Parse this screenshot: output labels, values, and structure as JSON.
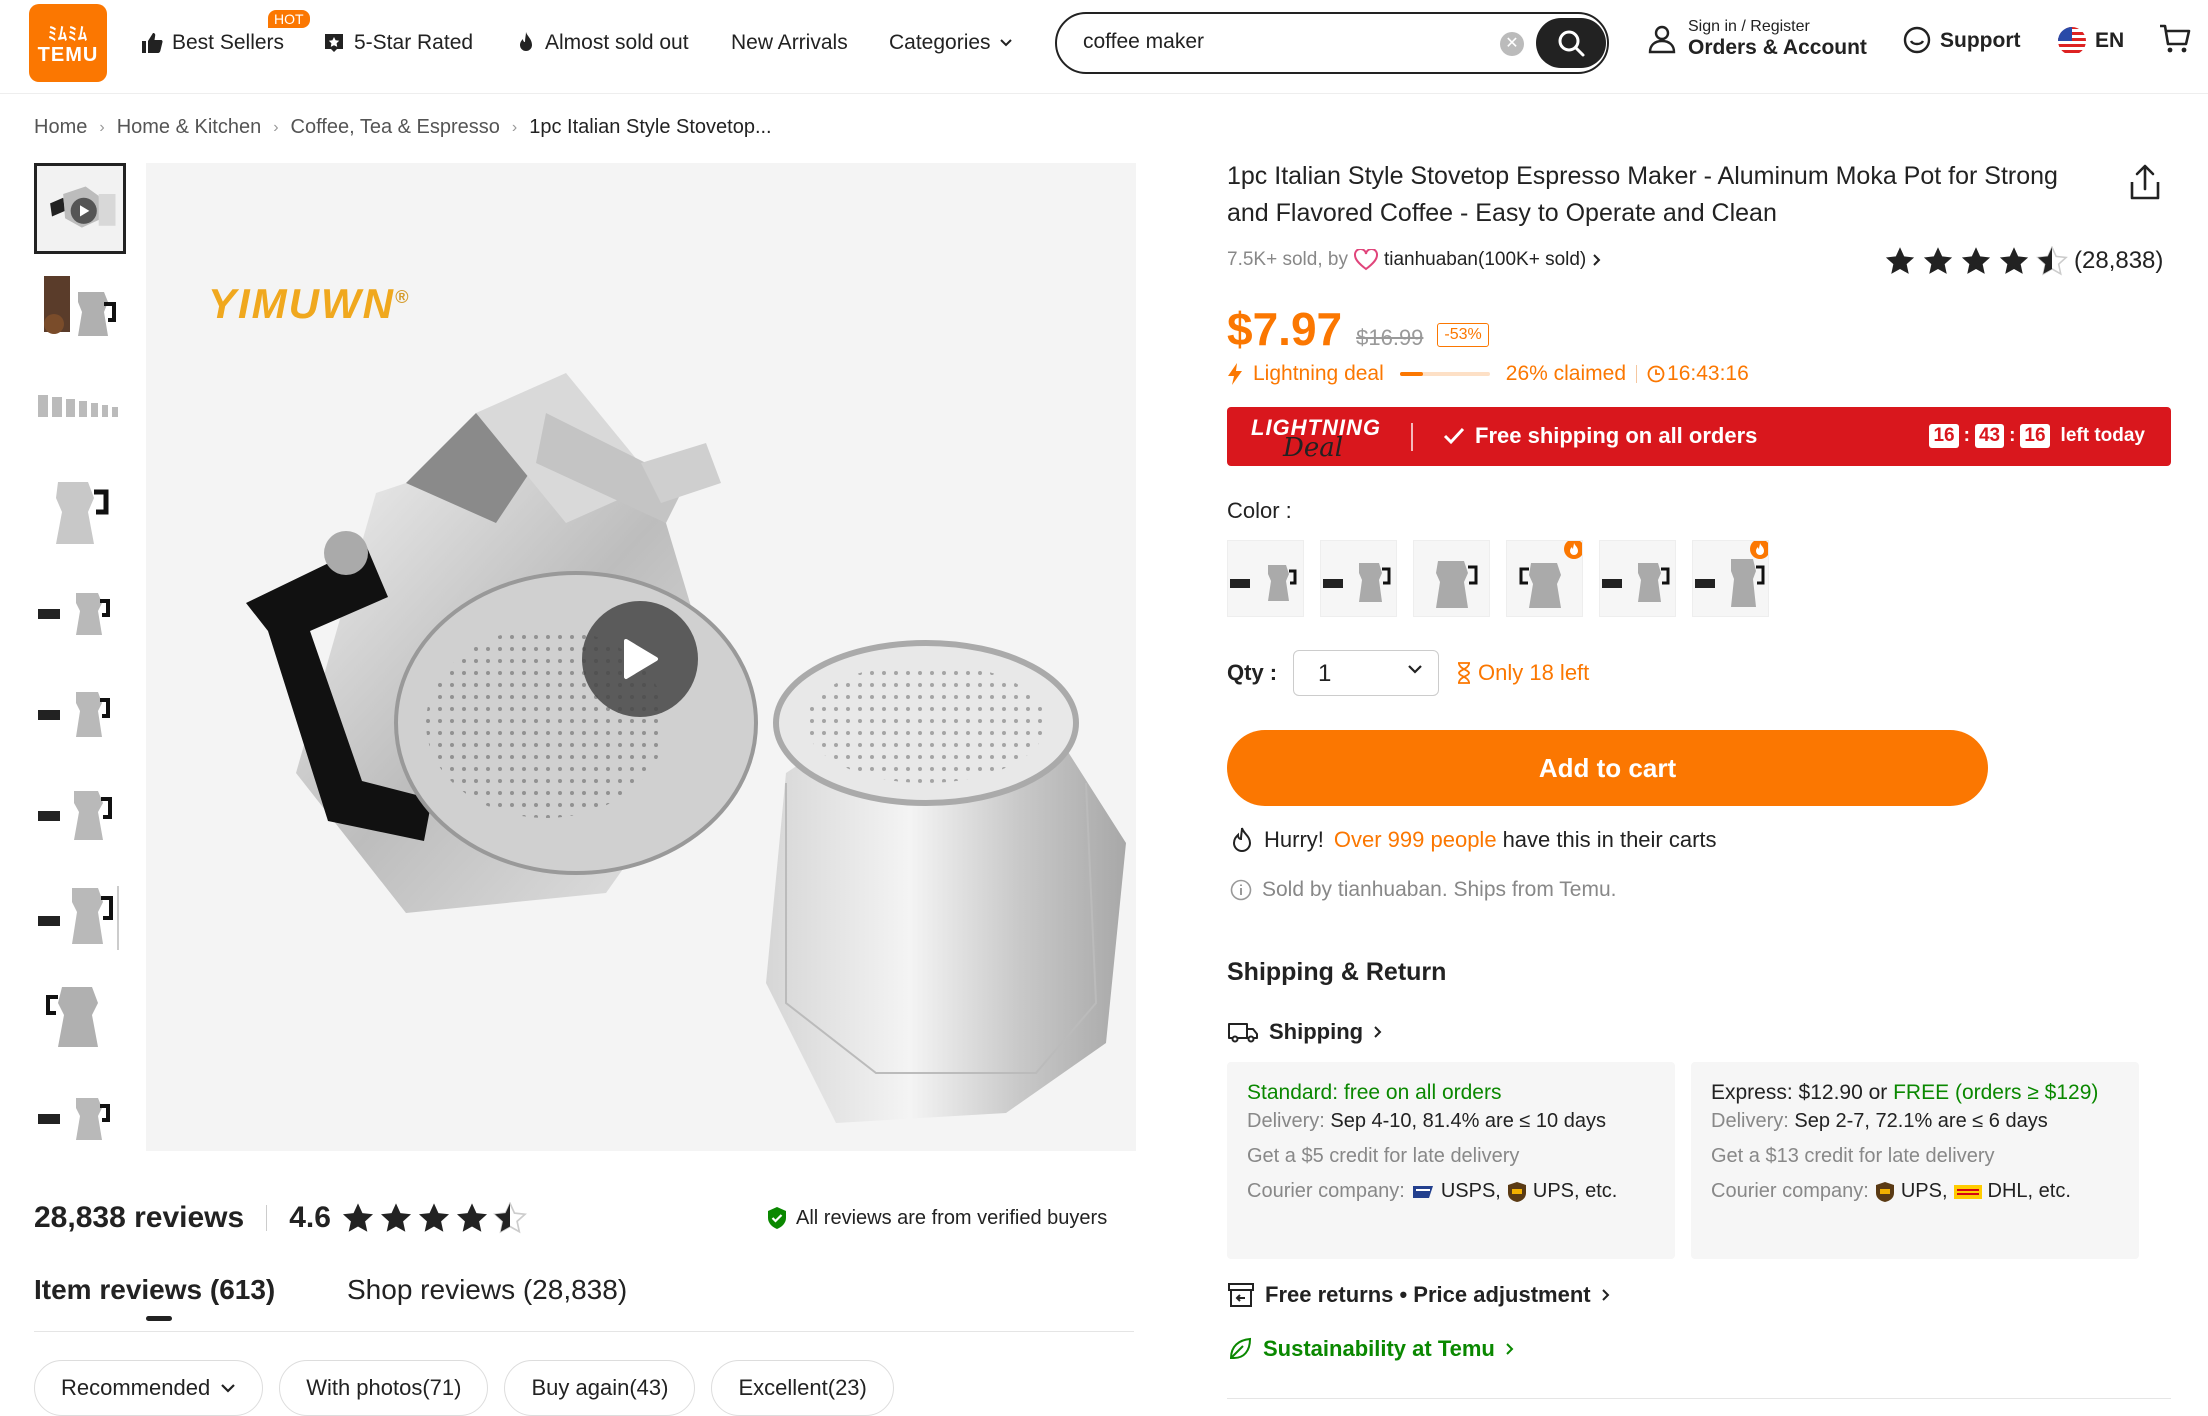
{
  "header": {
    "logo_top": "ﾐﾑﾐﾑ",
    "logo_bottom": "TEMU",
    "nav": [
      {
        "label": "Best Sellers",
        "badge": "HOT"
      },
      {
        "label": "5-Star Rated"
      },
      {
        "label": "Almost sold out"
      },
      {
        "label": "New Arrivals"
      },
      {
        "label": "Categories"
      }
    ],
    "search_value": "coffee maker",
    "account_small": "Sign in / Register",
    "account_big": "Orders & Account",
    "support": "Support",
    "language": "EN"
  },
  "breadcrumb": [
    "Home",
    "Home & Kitchen",
    "Coffee, Tea & Espresso",
    "1pc Italian Style Stovetop..."
  ],
  "gallery": {
    "brand_text": "YIMUWN",
    "brand_mark": "®"
  },
  "reviews": {
    "count_text": "28,838 reviews",
    "rating": "4.6",
    "verified_text": "All reviews are from verified buyers",
    "tabs": [
      "Item reviews (613)",
      "Shop reviews (28,838)"
    ],
    "filters": [
      "Recommended",
      "With photos(71)",
      "Buy again(43)",
      "Excellent(23)"
    ]
  },
  "product": {
    "title": "1pc Italian Style Stovetop Espresso Maker - Aluminum Moka Pot for Strong and Flavored Coffee - Easy to Operate and Clean",
    "sold_text": "7.5K+ sold, by",
    "shop_name": "tianhuaban(100K+ sold)",
    "rating_count": "(28,838)",
    "rating_value": 4.6,
    "price_now": "$7.97",
    "price_old": "$16.99",
    "discount": "-53%",
    "deal_label": "Lightning deal",
    "claimed": "26% claimed",
    "claimed_fraction": 0.26,
    "deal_timer": "16:43:16",
    "banner_lightning": "LIGHTNING",
    "banner_deal": "Deal",
    "banner_free": "Free shipping on all orders",
    "banner_h": "16",
    "banner_m": "43",
    "banner_s": "16",
    "banner_left": "left today",
    "color_label": "Color :",
    "qty_label": "Qty :",
    "qty_value": "1",
    "only_left": "Only 18 left",
    "add_to_cart": "Add to cart",
    "hurry_prefix": "Hurry!",
    "hurry_people": "Over 999 people",
    "hurry_suffix": "have this in their carts",
    "sold_by_info": "Sold by tianhuaban. Ships from Temu."
  },
  "shipping": {
    "heading": "Shipping & Return",
    "link": "Shipping",
    "standard": {
      "title": "Standard: free on all orders",
      "delivery_label": "Delivery:",
      "delivery_value": "Sep 4-10, 81.4% are ≤ 10 days",
      "credit": "Get a $5 credit for late delivery",
      "courier_label": "Courier company:",
      "courier_1": "USPS,",
      "courier_2": "UPS, etc."
    },
    "express": {
      "title_dark": "Express: $12.90 or",
      "title_green": "FREE (orders ≥ $129)",
      "delivery_label": "Delivery:",
      "delivery_value": "Sep 2-7, 72.1% are ≤ 6 days",
      "credit": "Get a $13 credit for late delivery",
      "courier_label": "Courier company:",
      "courier_1": "UPS,",
      "courier_2": "DHL, etc."
    },
    "returns": "Free returns • Price adjustment",
    "sustainability": "Sustainability at Temu"
  },
  "colors": {
    "accent": "#fb7701",
    "banner_red": "#d9171d",
    "green": "#0a8800"
  }
}
